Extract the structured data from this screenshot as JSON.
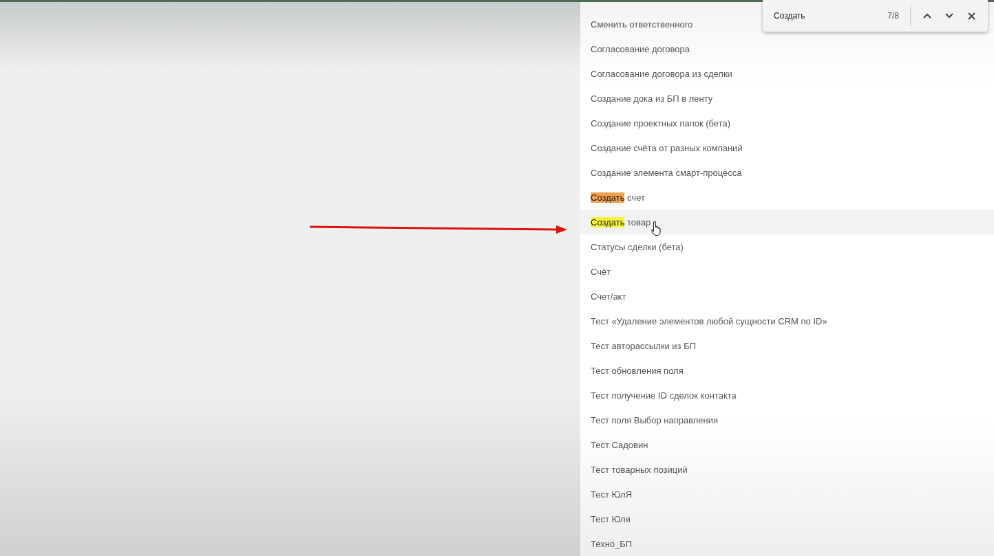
{
  "find_bar": {
    "value": "Создать",
    "count": "7/8"
  },
  "list": {
    "items": [
      {
        "text": "Сменить ответственного",
        "hovered": false
      },
      {
        "text": "Согласование договора",
        "hovered": false
      },
      {
        "text": "Согласование договора из сделки",
        "hovered": false
      },
      {
        "text": "Создание дока из БП в ленту",
        "hovered": false
      },
      {
        "text": "Создание проектных папок (бета)",
        "hovered": false
      },
      {
        "text": "Создание счёта от разных компаний",
        "hovered": false
      },
      {
        "text": "Создание элемента смарт-процесса",
        "hovered": false
      },
      {
        "match": "Создать",
        "current": true,
        "text": " счет",
        "hovered": false
      },
      {
        "match": "Создать",
        "current": false,
        "text": " товар",
        "hovered": true
      },
      {
        "text": "Статусы сделки (бета)",
        "hovered": false
      },
      {
        "text": "Счёт",
        "hovered": false
      },
      {
        "text": "Счет/акт",
        "hovered": false
      },
      {
        "text": "Тест «Удаление элементов любой сущности CRM по ID»",
        "hovered": false
      },
      {
        "text": "Тест авторассылки из БП",
        "hovered": false
      },
      {
        "text": "Тест обновления поля",
        "hovered": false
      },
      {
        "text": "Тест получение ID сделок контакта",
        "hovered": false
      },
      {
        "text": "Тест поля Выбор направления",
        "hovered": false
      },
      {
        "text": "Тест Садовин",
        "hovered": false
      },
      {
        "text": "Тест товарных позиций",
        "hovered": false
      },
      {
        "text": "Тест ЮлЯ",
        "hovered": false
      },
      {
        "text": "Тест Юля",
        "hovered": false
      },
      {
        "text": "Техно_БП",
        "hovered": false
      }
    ]
  }
}
